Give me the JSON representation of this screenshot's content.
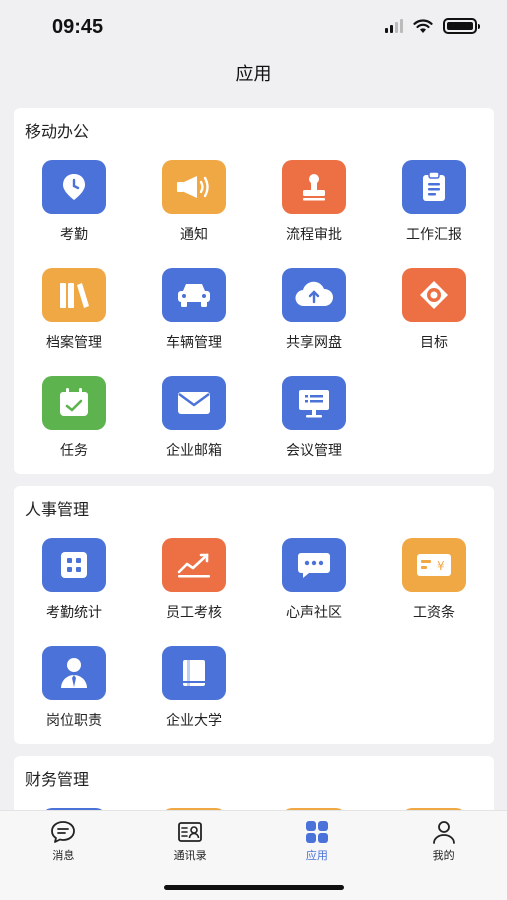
{
  "status": {
    "time": "09:45"
  },
  "header": {
    "title": "应用"
  },
  "sections": [
    {
      "title": "移动办公",
      "apps": [
        {
          "label": "考勤",
          "icon": "location-pin-icon",
          "color": "blue"
        },
        {
          "label": "通知",
          "icon": "megaphone-icon",
          "color": "orange"
        },
        {
          "label": "流程审批",
          "icon": "stamp-icon",
          "color": "red"
        },
        {
          "label": "工作汇报",
          "icon": "clipboard-icon",
          "color": "blue"
        },
        {
          "label": "档案管理",
          "icon": "books-icon",
          "color": "orange"
        },
        {
          "label": "车辆管理",
          "icon": "car-icon",
          "color": "blue"
        },
        {
          "label": "共享网盘",
          "icon": "cloud-upload-icon",
          "color": "blue"
        },
        {
          "label": "目标",
          "icon": "target-icon",
          "color": "red"
        },
        {
          "label": "任务",
          "icon": "calendar-check-icon",
          "color": "green"
        },
        {
          "label": "企业邮箱",
          "icon": "mail-icon",
          "color": "blue"
        },
        {
          "label": "会议管理",
          "icon": "presentation-board-icon",
          "color": "blue"
        }
      ]
    },
    {
      "title": "人事管理",
      "apps": [
        {
          "label": "考勤统计",
          "icon": "stats-grid-icon",
          "color": "blue"
        },
        {
          "label": "员工考核",
          "icon": "trend-chart-icon",
          "color": "red"
        },
        {
          "label": "心声社区",
          "icon": "chat-bubble-icon",
          "color": "blue"
        },
        {
          "label": "工资条",
          "icon": "salary-card-icon",
          "color": "orange"
        },
        {
          "label": "岗位职责",
          "icon": "person-tie-icon",
          "color": "blue"
        },
        {
          "label": "企业大学",
          "icon": "book-icon",
          "color": "blue"
        }
      ]
    },
    {
      "title": "财务管理",
      "apps": [
        {
          "label": "",
          "icon": "partial-icon",
          "color": "blue"
        },
        {
          "label": "",
          "icon": "partial-icon",
          "color": "orange"
        },
        {
          "label": "",
          "icon": "partial-icon",
          "color": "orange"
        },
        {
          "label": "",
          "icon": "partial-icon",
          "color": "orange"
        }
      ]
    }
  ],
  "tabbar": {
    "tabs": [
      {
        "label": "消息",
        "icon": "message-icon"
      },
      {
        "label": "通讯录",
        "icon": "contacts-icon"
      },
      {
        "label": "应用",
        "icon": "apps-grid-icon",
        "active": true
      },
      {
        "label": "我的",
        "icon": "profile-icon"
      }
    ]
  },
  "colors": {
    "blue": "#4a72d9",
    "orange": "#f0a845",
    "red": "#ec7043",
    "green": "#5db44f"
  }
}
